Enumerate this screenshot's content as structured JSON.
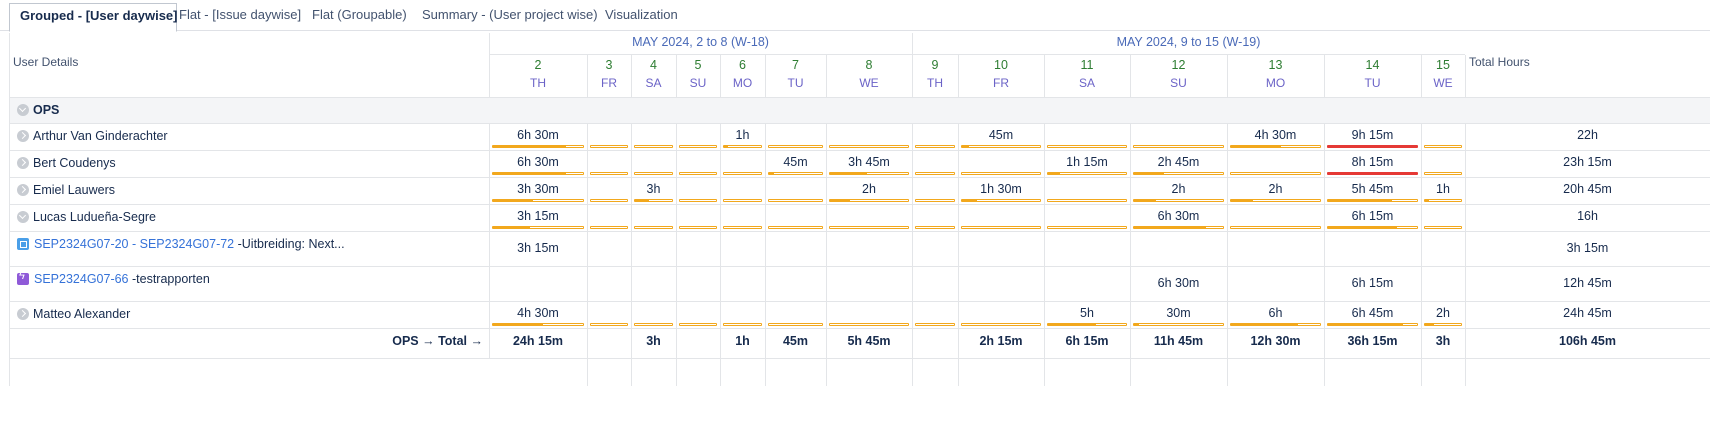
{
  "tabs": [
    {
      "label": "Grouped - [User daywise]",
      "active": true
    },
    {
      "label": "Flat - [Issue daywise]"
    },
    {
      "label": "Flat (Groupable)"
    },
    {
      "label": "Summary - (User project wise)"
    },
    {
      "label": "Visualization"
    }
  ],
  "header": {
    "user_details": "User Details",
    "total_hours": "Total Hours",
    "weeks": [
      "MAY 2024, 2 to 8 (W-18)",
      "MAY 2024, 9 to 15 (W-19)"
    ]
  },
  "days": [
    {
      "num": "2",
      "name": "TH"
    },
    {
      "num": "3",
      "name": "FR"
    },
    {
      "num": "4",
      "name": "SA"
    },
    {
      "num": "5",
      "name": "SU"
    },
    {
      "num": "6",
      "name": "MO"
    },
    {
      "num": "7",
      "name": "TU"
    },
    {
      "num": "8",
      "name": "WE"
    },
    {
      "num": "9",
      "name": "TH"
    },
    {
      "num": "10",
      "name": "FR"
    },
    {
      "num": "11",
      "name": "SA"
    },
    {
      "num": "12",
      "name": "SU"
    },
    {
      "num": "13",
      "name": "MO"
    },
    {
      "num": "14",
      "name": "TU"
    },
    {
      "num": "15",
      "name": "WE"
    }
  ],
  "group": {
    "label": "OPS"
  },
  "rows": [
    {
      "label": "Arthur Van Ginderachter",
      "type": "user",
      "cells": [
        "6h 30m",
        "",
        "",
        "",
        "1h",
        "",
        "",
        "",
        "45m",
        "",
        "",
        "4h 30m",
        "9h 15m",
        ""
      ],
      "fill": [
        0.81,
        0,
        0,
        0,
        0.12,
        0,
        0,
        0,
        0.09,
        0,
        0,
        0.56,
        1.15,
        0
      ],
      "total": "22h"
    },
    {
      "label": "Bert Coudenys",
      "type": "user",
      "cells": [
        "6h 30m",
        "",
        "",
        "",
        "",
        "45m",
        "3h 45m",
        "",
        "",
        "1h 15m",
        "2h 45m",
        "",
        "8h 15m",
        ""
      ],
      "fill": [
        0.81,
        0,
        0,
        0,
        0,
        0.09,
        0.47,
        0,
        0,
        0.16,
        0.34,
        0,
        1.03,
        0
      ],
      "total": "23h 15m"
    },
    {
      "label": "Emiel Lauwers",
      "type": "user",
      "cells": [
        "3h 30m",
        "",
        "3h",
        "",
        "",
        "",
        "2h",
        "",
        "1h 30m",
        "",
        "2h",
        "2h",
        "5h 45m",
        "1h"
      ],
      "fill": [
        0.44,
        0,
        0.37,
        0,
        0,
        0,
        0.25,
        0,
        0.19,
        0,
        0.25,
        0.25,
        0.72,
        0.12
      ],
      "total": "20h 45m"
    },
    {
      "label": "Lucas Ludueña-Segre",
      "type": "user",
      "open": true,
      "cells": [
        "3h 15m",
        "",
        "",
        "",
        "",
        "",
        "",
        "",
        "",
        "",
        "6h 30m",
        "",
        "6h 15m",
        ""
      ],
      "fill": [
        0.41,
        0,
        0,
        0,
        0,
        0,
        0,
        0,
        0,
        0,
        0.81,
        0,
        0.78,
        0
      ],
      "total": "16h"
    },
    {
      "type": "issue",
      "icon": "subtask",
      "link1": "SEP2324G07-20",
      "sep": " - ",
      "link2": "SEP2324G07-72",
      "desc": " -Uitbreiding: Next...",
      "cells": [
        "3h 15m",
        "",
        "",
        "",
        "",
        "",
        "",
        "",
        "",
        "",
        "",
        "",
        "",
        ""
      ],
      "total": "3h 15m"
    },
    {
      "type": "issue",
      "icon": "epic",
      "link1": "SEP2324G07-66",
      "desc": " -testrapporten",
      "cells": [
        "",
        "",
        "",
        "",
        "",
        "",
        "",
        "",
        "",
        "",
        "6h 30m",
        "",
        "6h 15m",
        ""
      ],
      "total": "12h 45m"
    },
    {
      "label": "Matteo Alexander",
      "type": "user",
      "cells": [
        "4h 30m",
        "",
        "",
        "",
        "",
        "",
        "",
        "",
        "",
        "5h",
        "30m",
        "6h",
        "6h 45m",
        "2h"
      ],
      "fill": [
        0.56,
        0,
        0,
        0,
        0,
        0,
        0,
        0,
        0,
        0.62,
        0.06,
        0.75,
        0.84,
        0.25
      ],
      "total": "24h 45m"
    }
  ],
  "totals": {
    "label": "OPS → Total →",
    "cells": [
      "24h 15m",
      "",
      "3h",
      "",
      "1h",
      "45m",
      "5h 45m",
      "",
      "2h 15m",
      "6h 15m",
      "11h 45m",
      "12h 30m",
      "36h 15m",
      "3h"
    ],
    "total": "106h 45m"
  },
  "colors": {
    "bar": "#f2a81d",
    "over": "#e53935",
    "link": "#3572d8"
  }
}
